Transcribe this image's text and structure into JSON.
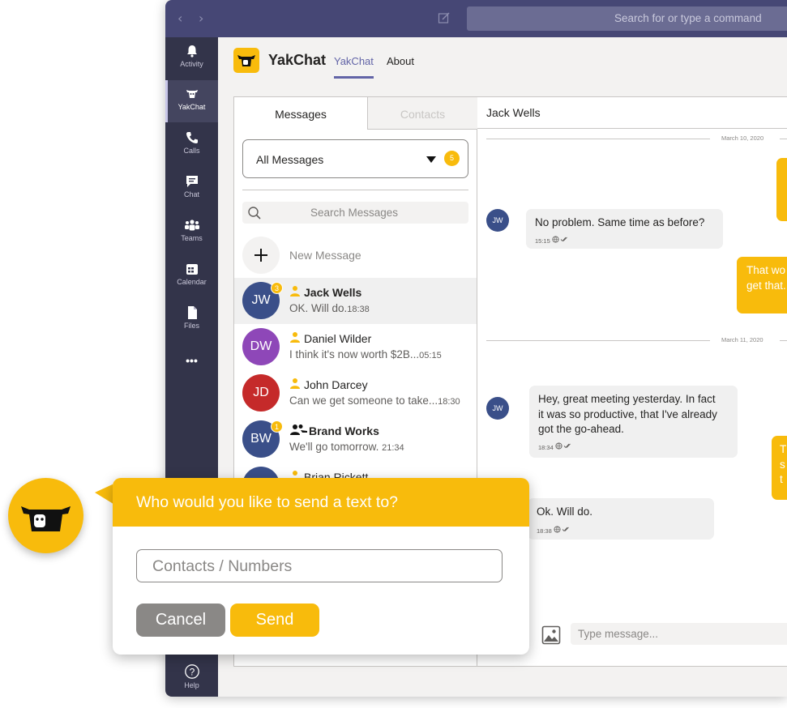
{
  "titlebar": {
    "back_arrow": "‹",
    "forward_arrow": "›",
    "search_placeholder": "Search for or type a command"
  },
  "rail": {
    "items": [
      {
        "label": "Activity",
        "icon": "bell-icon"
      },
      {
        "label": "YakChat",
        "icon": "yakchat-icon"
      },
      {
        "label": "Calls",
        "icon": "phone-icon"
      },
      {
        "label": "Chat",
        "icon": "chat-icon"
      },
      {
        "label": "Teams",
        "icon": "teams-icon"
      },
      {
        "label": "Calendar",
        "icon": "calendar-icon"
      },
      {
        "label": "Files",
        "icon": "files-icon"
      },
      {
        "label": "•••",
        "icon": "more-icon"
      },
      {
        "label": "Help",
        "icon": "help-icon"
      }
    ]
  },
  "app": {
    "name": "YakChat",
    "tabs": [
      "YakChat",
      "About"
    ],
    "accent": "#f8bb0c",
    "teams_purple": "#6264a7"
  },
  "messages_panel": {
    "tabs": [
      "Messages",
      "Contacts"
    ],
    "filter": {
      "value": "All Messages",
      "count": "5"
    },
    "search_placeholder": "Search Messages",
    "new_message_label": "New Message",
    "conversations": [
      {
        "initials": "JW",
        "name": "Jack Wells",
        "preview": "OK. Will do.",
        "time": "18:38",
        "badge": "3",
        "color": "#3a4f89",
        "kind": "person"
      },
      {
        "initials": "DW",
        "name": "Daniel Wilder",
        "preview": "I think it's now worth $2B...",
        "time": "05:15",
        "badge": "",
        "color": "#8e47b8",
        "kind": "person"
      },
      {
        "initials": "JD",
        "name": "John Darcey",
        "preview": "Can we get someone to take...",
        "time": "18:30",
        "badge": "",
        "color": "#c52a2a",
        "kind": "person"
      },
      {
        "initials": "BW",
        "name": "Brand Works",
        "preview": "We'll go tomorrow.",
        "time": "21:34",
        "badge": "1",
        "color": "#3a4f89",
        "kind": "group"
      },
      {
        "initials": "BR",
        "name": "Brian Rickett",
        "preview": "",
        "time": "",
        "badge": "",
        "color": "#3a4f89",
        "kind": "person"
      }
    ]
  },
  "chat": {
    "contact": "Jack Wells",
    "dates": [
      "March 10, 2020",
      "March 11, 2020"
    ],
    "messages": [
      {
        "dir": "in",
        "initials": "JW",
        "text": "No problem. Same time as before?",
        "time": "15:15"
      },
      {
        "dir": "out",
        "line1": "That wo",
        "line2": "get that."
      },
      {
        "dir": "in",
        "initials": "JW",
        "line1": "Hey, great meeting yesterday. In fact",
        "line2": "it was so productive, that I've already",
        "line3": "got the go-ahead.",
        "time": "18:34"
      },
      {
        "dir": "out",
        "line1": "T",
        "line2": "s",
        "line3": "t"
      },
      {
        "dir": "in",
        "text": "Ok. Will do.",
        "time": "18:38"
      }
    ],
    "composer_placeholder": "Type message..."
  },
  "modal": {
    "title": "Who would you like to send a text to?",
    "input_placeholder": "Contacts / Numbers",
    "cancel_label": "Cancel",
    "send_label": "Send"
  }
}
